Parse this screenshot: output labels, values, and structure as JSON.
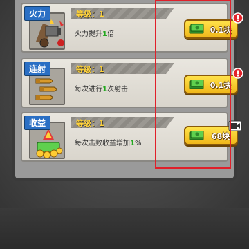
{
  "upgrades": [
    {
      "tag": "火力",
      "level_label": "等级：1",
      "desc_before": "火力提升",
      "desc_value": "1",
      "desc_after": "倍",
      "price": "0.1块",
      "badge": "alert-icon",
      "icon": "cannon-icon"
    },
    {
      "tag": "连射",
      "level_label": "等级：1",
      "desc_before": "每次进行",
      "desc_value": "1",
      "desc_after": "次射击",
      "price": "0.1块",
      "badge": "alert-icon",
      "icon": "bullets-icon"
    },
    {
      "tag": "收益",
      "level_label": "等级：1",
      "desc_before": "每次击败收益增加",
      "desc_value": "1",
      "desc_after": "%",
      "price": "68块",
      "badge": "video-icon",
      "icon": "treasure-icon"
    }
  ],
  "colors": {
    "highlight_box": "#e0202a",
    "tag_bg": "#2a6fc4",
    "button_bg": "#f0b71a",
    "level_text": "#ffd23a",
    "value_text": "#22a81f"
  }
}
